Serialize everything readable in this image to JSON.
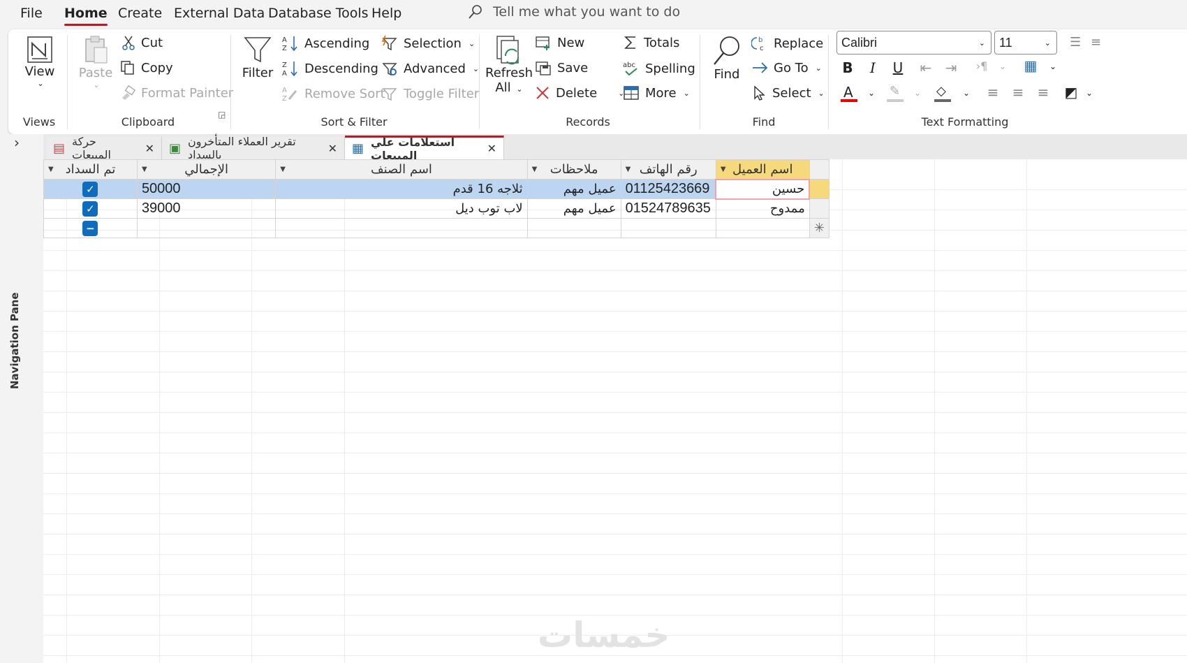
{
  "menu": {
    "items": [
      "File",
      "Home",
      "Create",
      "External Data",
      "Database Tools",
      "Help"
    ],
    "active": "Home",
    "tell_me": "Tell me what you want to do"
  },
  "ribbon": {
    "views": {
      "view": "View",
      "label": "Views"
    },
    "clipboard": {
      "paste": "Paste",
      "cut": "Cut",
      "copy": "Copy",
      "format_painter": "Format Painter",
      "label": "Clipboard"
    },
    "sort_filter": {
      "filter": "Filter",
      "ascending": "Ascending",
      "descending": "Descending",
      "remove_sort": "Remove Sort",
      "selection": "Selection",
      "advanced": "Advanced",
      "toggle_filter": "Toggle Filter",
      "label": "Sort & Filter"
    },
    "records": {
      "refresh": "Refresh",
      "refresh_all": "All",
      "new": "New",
      "save": "Save",
      "delete": "Delete",
      "totals": "Totals",
      "spelling": "Spelling",
      "more": "More",
      "label": "Records"
    },
    "find": {
      "find": "Find",
      "replace": "Replace",
      "goto": "Go To",
      "select": "Select",
      "label": "Find"
    },
    "text_formatting": {
      "font": "Calibri",
      "size": "11",
      "bold": "B",
      "italic": "I",
      "underline": "U",
      "label": "Text Formatting"
    }
  },
  "nav_pane": {
    "label": "Navigation Pane"
  },
  "tabs": [
    {
      "label": "استعلامات علي المبيعات",
      "active": true
    },
    {
      "label": "تقرير العملاء المتأخرون بالسداد",
      "active": false
    },
    {
      "label": "حركة المبيعات",
      "active": false
    }
  ],
  "table": {
    "columns": [
      "اسم العميل",
      "رقم الهاتف",
      "ملاحظات",
      "اسم الصنف",
      "الإجمالي",
      "تم السداد"
    ],
    "rows": [
      {
        "name": "حسين",
        "phone": "01125423669",
        "notes": "عميل مهم",
        "item": "ثلاجه 16 قدم",
        "total": "50000",
        "paid": true
      },
      {
        "name": "ممدوح",
        "phone": "01524789635",
        "notes": "عميل مهم",
        "item": "لاب توب ديل",
        "total": "39000",
        "paid": true
      }
    ]
  },
  "watermark": "خمسات",
  "colors": {
    "accent": "#a4262c",
    "selection": "#bcd6f1",
    "checkbox": "#0f6cbd",
    "header_selected": "#f5d97c"
  }
}
